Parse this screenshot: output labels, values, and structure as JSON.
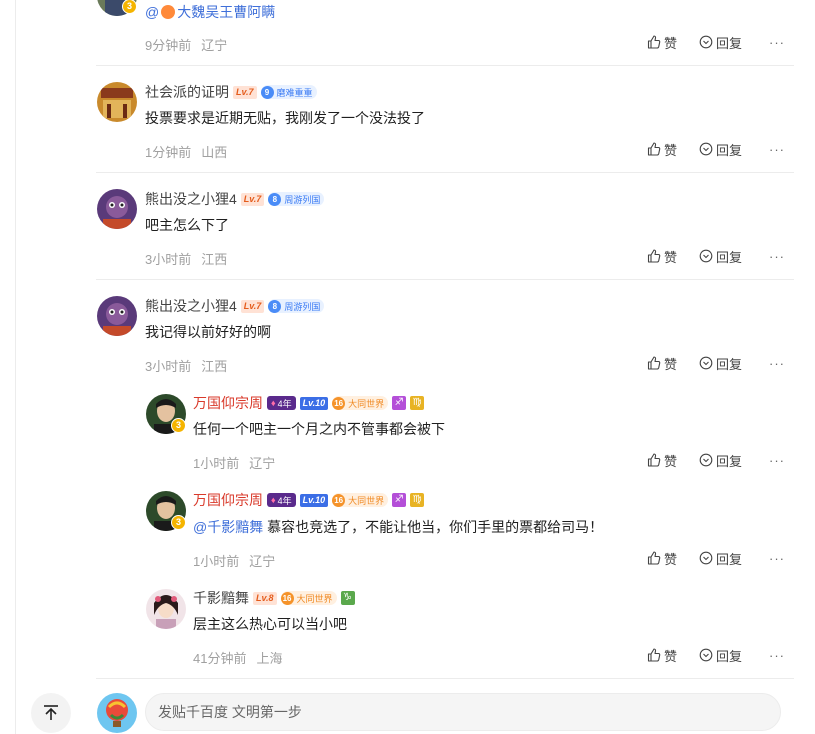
{
  "input": {
    "placeholder": "发贴千百度 文明第一步"
  },
  "comments": [
    {
      "mention": "@",
      "mention_user": "大魏吴王曹阿瞒",
      "time": "9分钟前",
      "location": "辽宁",
      "avatar_badge": "3"
    },
    {
      "username": "社会派的证明",
      "level": "Lv.7",
      "tag_num": "9",
      "tag_text": "磨难重重",
      "text": "投票要求是近期无贴，我刚发了一个没法投了",
      "time": "1分钟前",
      "location": "山西"
    },
    {
      "username": "熊出没之小狸4",
      "level": "Lv.7",
      "tag_num": "8",
      "tag_text": "周游列国",
      "text": "吧主怎么下了",
      "time": "3小时前",
      "location": "江西"
    },
    {
      "username": "熊出没之小狸4",
      "level": "Lv.7",
      "tag_num": "8",
      "tag_text": "周游列国",
      "text": "我记得以前好好的啊",
      "time": "3小时前",
      "location": "江西"
    }
  ],
  "replies": [
    {
      "username": "万国仰宗周",
      "year_tag": "4年",
      "level": "Lv.10",
      "tag_num": "16",
      "tag_text": "大同世界",
      "zodiac1": "♐",
      "zodiac2": "♍",
      "text": "任何一个吧主一个月之内不管事都会被下",
      "time": "1小时前",
      "location": "辽宁",
      "avatar_badge": "3"
    },
    {
      "username": "万国仰宗周",
      "year_tag": "4年",
      "level": "Lv.10",
      "tag_num": "16",
      "tag_text": "大同世界",
      "zodiac1": "♐",
      "zodiac2": "♍",
      "mention": "@千影黯舞",
      "text": " 慕容也竞选了，不能让他当，你们手里的票都给司马！",
      "time": "1小时前",
      "location": "辽宁",
      "avatar_badge": "3"
    },
    {
      "username": "千影黯舞",
      "level": "Lv.8",
      "tag_num": "16",
      "tag_text": "大同世界",
      "zodiac1": "♑",
      "text": "层主这么热心可以当小吧",
      "time": "41分钟前",
      "location": "上海"
    }
  ],
  "labels": {
    "like": "赞",
    "reply": "回复",
    "more": "···"
  },
  "colors": {
    "username_red": "#d93a2b",
    "mention_blue": "#3f6fd9",
    "meta_gray": "#a0a0a0"
  }
}
